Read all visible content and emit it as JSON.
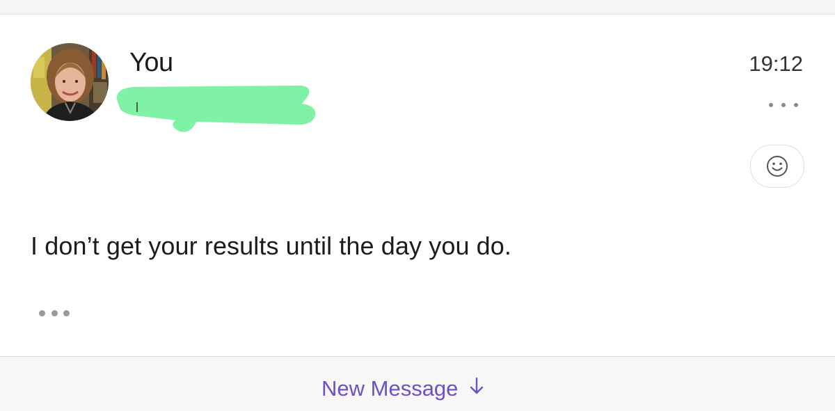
{
  "message": {
    "sender": "You",
    "time": "19:12",
    "body": "I don’t get your results until the day you do."
  },
  "footer": {
    "new_message_label": "New Message"
  },
  "icons": {
    "more": "more-horizontal-icon",
    "reaction": "smiley-icon",
    "expand": "ellipsis-icon",
    "new_message_arrow": "arrow-down-icon"
  },
  "colors": {
    "accent": "#6e4fc4",
    "redaction": "#7ff2a5",
    "background": "#ffffff",
    "footer_background": "#f7f7f7"
  }
}
